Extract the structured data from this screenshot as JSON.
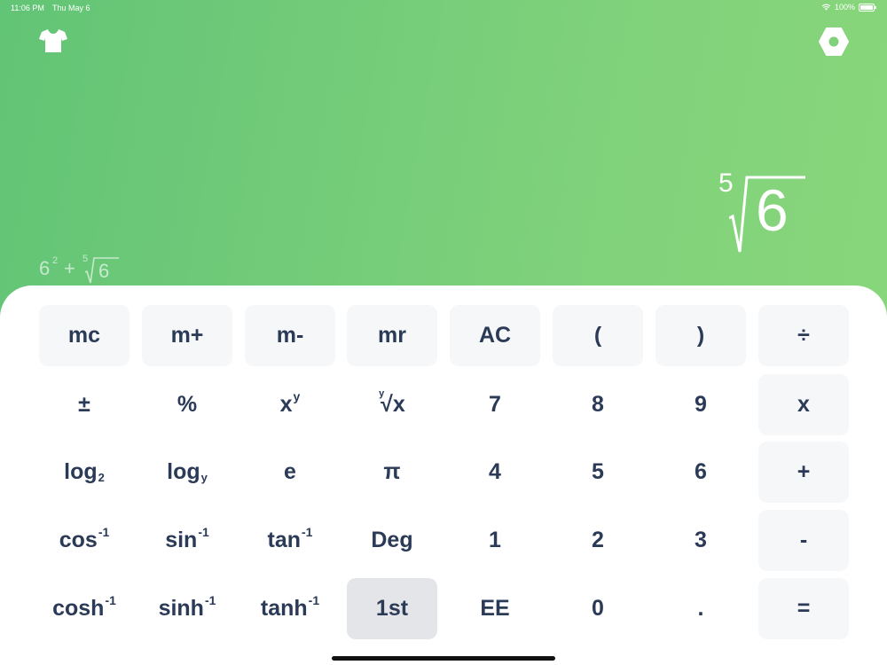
{
  "status_bar": {
    "time": "11:06 PM",
    "date": "Thu May 6",
    "battery": "100%"
  },
  "top_bar": {
    "theme_icon": "tshirt-icon",
    "settings_icon": "hexagon-nut-icon"
  },
  "display": {
    "root_index": "5",
    "radicand": "6"
  },
  "history": {
    "base": "6",
    "exponent": "2",
    "operator": "+",
    "root_index": "5",
    "radicand": "6"
  },
  "keypad": {
    "row1": [
      "mc",
      "m+",
      "m-",
      "mr",
      "AC",
      "(",
      ")",
      "÷"
    ],
    "row2": {
      "sign": "±",
      "percent": "%",
      "power_base": "x",
      "power_exp": "y",
      "root_index": "y",
      "root_sign": "√",
      "root_var": "x",
      "seven": "7",
      "eight": "8",
      "nine": "9",
      "multiply": "x"
    },
    "row3": {
      "log2_base": "log",
      "log2_sub": "2",
      "logy_base": "log",
      "logy_sub": "y",
      "e": "e",
      "pi": "π",
      "four": "4",
      "five": "5",
      "six": "6",
      "plus": "+"
    },
    "row4": {
      "acos": "cos",
      "asin": "sin",
      "atan": "tan",
      "inv": "-1",
      "deg": "Deg",
      "one": "1",
      "two": "2",
      "three": "3",
      "minus": "-"
    },
    "row5": {
      "acosh": "cosh",
      "asinh": "sinh",
      "atanh": "tanh",
      "inv": "-1",
      "first": "1st",
      "ee": "EE",
      "zero": "0",
      "dot": ".",
      "equals": "="
    }
  },
  "colors": {
    "gradient_start": "#62c476",
    "gradient_end": "#8ad77b",
    "key_text": "#2b3a57",
    "key_shaded": "#f6f7f9",
    "key_active": "#e4e5e8"
  }
}
